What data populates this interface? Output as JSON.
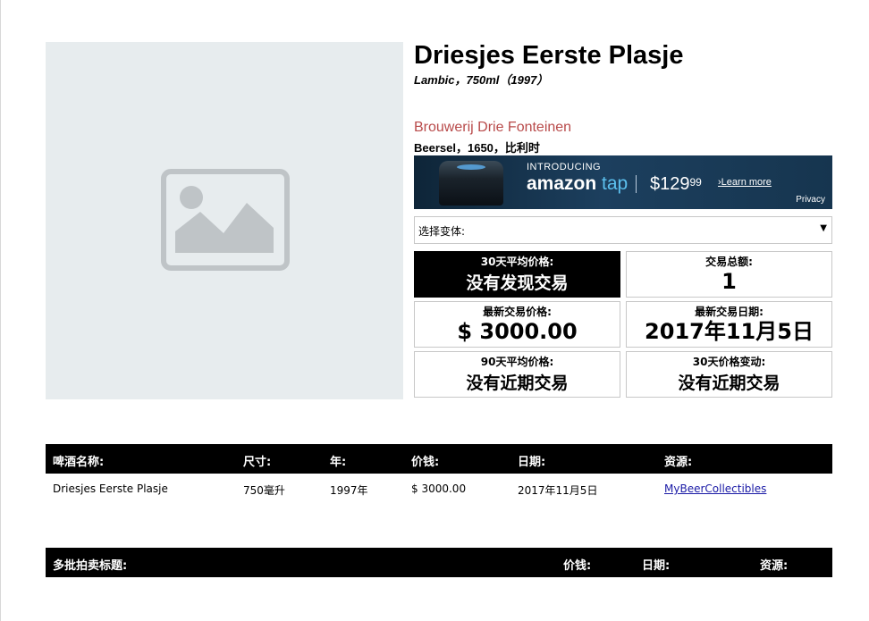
{
  "beer": {
    "name": "Driesjes Eerste Plasje",
    "subtitle": "Lambic，750ml（1997）",
    "brewery": "Brouwerij Drie Fonteinen",
    "location": "Beersel，1650，比利时"
  },
  "ad": {
    "intro": "INTRODUCING",
    "brand": "amazon",
    "brand_suffix": "tap",
    "price_main": "$129",
    "price_cents": "99",
    "learn": "Learn more",
    "privacy": "Privacy"
  },
  "variant": {
    "label": "选择变体:",
    "arrow": "▼"
  },
  "stats": {
    "avg30_label": "30天平均价格:",
    "avg30_value": "没有发现交易",
    "total_label": "交易总额:",
    "total_value": "1",
    "last_price_label": "最新交易价格:",
    "last_price_value": "$ 3000.00",
    "last_date_label": "最新交易日期:",
    "last_date_value": "2017年11月5日",
    "avg90_label": "90天平均价格:",
    "avg90_value": "没有近期交易",
    "change30_label": "30天价格变动:",
    "change30_value": "没有近期交易"
  },
  "sales_table": {
    "headers": [
      "啤酒名称:",
      "尺寸:",
      "年:",
      "价钱:",
      "日期:",
      "资源:"
    ],
    "rows": [
      [
        "Driesjes Eerste Plasje",
        "750毫升",
        "1997年",
        "$ 3000.00",
        "2017年11月5日",
        "MyBeerCollectibles"
      ]
    ]
  },
  "lot_table": {
    "headers": [
      "多批拍卖标题:",
      "价钱:",
      "日期:",
      "资源:"
    ]
  },
  "colors": {
    "brewery": "#b84a4a",
    "placeholder_bg": "#e7ecee",
    "link": "#1a1aa6"
  }
}
